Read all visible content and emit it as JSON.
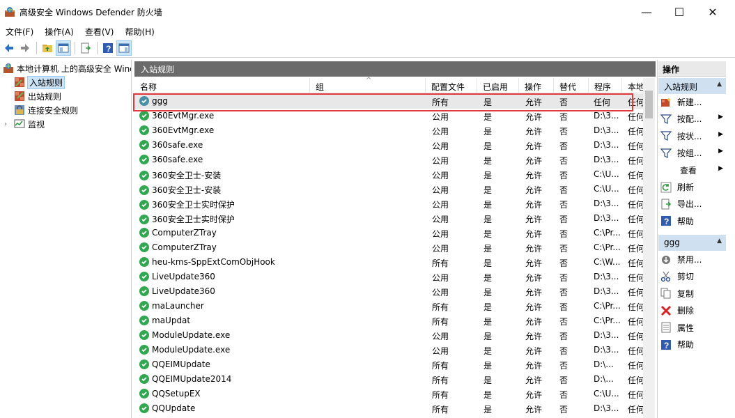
{
  "window": {
    "title": "高级安全 Windows Defender 防火墙",
    "minimize": "—",
    "maximize": "☐",
    "close": "✕"
  },
  "menu": [
    "文件(F)",
    "操作(A)",
    "查看(V)",
    "帮助(H)"
  ],
  "tree": {
    "root": "本地计算机 上的高级安全 Wind",
    "items": [
      "入站规则",
      "出站规则",
      "连接安全规则",
      "监视"
    ],
    "selected": "入站规则"
  },
  "center": {
    "header": "入站规则",
    "columns": [
      "名称",
      "组",
      "配置文件",
      "已启用",
      "操作",
      "替代",
      "程序",
      "本地"
    ],
    "rows": [
      {
        "name": "ggg",
        "group": "",
        "profile": "所有",
        "enabled": "是",
        "action": "允许",
        "override": "否",
        "program": "任何",
        "local": "任何",
        "status": "highlighted"
      },
      {
        "name": "360EvtMgr.exe",
        "group": "",
        "profile": "公用",
        "enabled": "是",
        "action": "允许",
        "override": "否",
        "program": "D:\\3...",
        "local": "任何"
      },
      {
        "name": "360EvtMgr.exe",
        "group": "",
        "profile": "公用",
        "enabled": "是",
        "action": "允许",
        "override": "否",
        "program": "D:\\3...",
        "local": "任何"
      },
      {
        "name": "360safe.exe",
        "group": "",
        "profile": "公用",
        "enabled": "是",
        "action": "允许",
        "override": "否",
        "program": "D:\\3...",
        "local": "任何"
      },
      {
        "name": "360safe.exe",
        "group": "",
        "profile": "公用",
        "enabled": "是",
        "action": "允许",
        "override": "否",
        "program": "D:\\3...",
        "local": "任何"
      },
      {
        "name": "360安全卫士-安装",
        "group": "",
        "profile": "公用",
        "enabled": "是",
        "action": "允许",
        "override": "否",
        "program": "C:\\U...",
        "local": "任何"
      },
      {
        "name": "360安全卫士-安装",
        "group": "",
        "profile": "公用",
        "enabled": "是",
        "action": "允许",
        "override": "否",
        "program": "C:\\U...",
        "local": "任何"
      },
      {
        "name": "360安全卫士实时保护",
        "group": "",
        "profile": "公用",
        "enabled": "是",
        "action": "允许",
        "override": "否",
        "program": "D:\\3...",
        "local": "任何"
      },
      {
        "name": "360安全卫士实时保护",
        "group": "",
        "profile": "公用",
        "enabled": "是",
        "action": "允许",
        "override": "否",
        "program": "D:\\3...",
        "local": "任何"
      },
      {
        "name": "ComputerZTray",
        "group": "",
        "profile": "公用",
        "enabled": "是",
        "action": "允许",
        "override": "否",
        "program": "C:\\Pr...",
        "local": "任何"
      },
      {
        "name": "ComputerZTray",
        "group": "",
        "profile": "公用",
        "enabled": "是",
        "action": "允许",
        "override": "否",
        "program": "C:\\Pr...",
        "local": "任何"
      },
      {
        "name": "heu-kms-SppExtComObjHook",
        "group": "",
        "profile": "所有",
        "enabled": "是",
        "action": "允许",
        "override": "否",
        "program": "C:\\W...",
        "local": "任何"
      },
      {
        "name": "LiveUpdate360",
        "group": "",
        "profile": "公用",
        "enabled": "是",
        "action": "允许",
        "override": "否",
        "program": "D:\\3...",
        "local": "任何"
      },
      {
        "name": "LiveUpdate360",
        "group": "",
        "profile": "公用",
        "enabled": "是",
        "action": "允许",
        "override": "否",
        "program": "D:\\3...",
        "local": "任何"
      },
      {
        "name": "maLauncher",
        "group": "",
        "profile": "所有",
        "enabled": "是",
        "action": "允许",
        "override": "否",
        "program": "C:\\Pr...",
        "local": "任何"
      },
      {
        "name": "maUpdat",
        "group": "",
        "profile": "所有",
        "enabled": "是",
        "action": "允许",
        "override": "否",
        "program": "C:\\Pr...",
        "local": "任何"
      },
      {
        "name": "ModuleUpdate.exe",
        "group": "",
        "profile": "公用",
        "enabled": "是",
        "action": "允许",
        "override": "否",
        "program": "D:\\3...",
        "local": "任何"
      },
      {
        "name": "ModuleUpdate.exe",
        "group": "",
        "profile": "公用",
        "enabled": "是",
        "action": "允许",
        "override": "否",
        "program": "D:\\3...",
        "local": "任何"
      },
      {
        "name": "QQEIMUpdate",
        "group": "",
        "profile": "所有",
        "enabled": "是",
        "action": "允许",
        "override": "否",
        "program": "D:\\...",
        "local": "任何"
      },
      {
        "name": "QQEIMUpdate2014",
        "group": "",
        "profile": "所有",
        "enabled": "是",
        "action": "允许",
        "override": "否",
        "program": "D:\\...",
        "local": "任何"
      },
      {
        "name": "QQSetupEX",
        "group": "",
        "profile": "所有",
        "enabled": "是",
        "action": "允许",
        "override": "否",
        "program": "C:\\U...",
        "local": "任何"
      },
      {
        "name": "QQUpdate",
        "group": "",
        "profile": "所有",
        "enabled": "是",
        "action": "允许",
        "override": "否",
        "program": "D:\\3...",
        "local": "任何"
      }
    ]
  },
  "actions": {
    "header": "操作",
    "section1": "入站规则",
    "section1_items": [
      {
        "label": "新建...",
        "icon": "new-rule-icon"
      },
      {
        "label": "按配...",
        "icon": "filter-icon",
        "submenu": true
      },
      {
        "label": "按状...",
        "icon": "filter-icon",
        "submenu": true
      },
      {
        "label": "按组...",
        "icon": "filter-icon",
        "submenu": true
      },
      {
        "label": "查看",
        "icon": "",
        "submenu": true
      },
      {
        "label": "刷新",
        "icon": "refresh-icon"
      },
      {
        "label": "导出...",
        "icon": "export-icon"
      },
      {
        "label": "帮助",
        "icon": "help-icon"
      }
    ],
    "section2": "ggg",
    "section2_items": [
      {
        "label": "禁用...",
        "icon": "disable-icon"
      },
      {
        "label": "剪切",
        "icon": "cut-icon"
      },
      {
        "label": "复制",
        "icon": "copy-icon"
      },
      {
        "label": "删除",
        "icon": "delete-icon"
      },
      {
        "label": "属性",
        "icon": "properties-icon"
      },
      {
        "label": "帮助",
        "icon": "help-icon"
      }
    ]
  },
  "colors": {
    "accent_highlight": "#e23a3a",
    "enabled_check": "#2fa84f",
    "pane_header": "#6b6b6b",
    "selection": "#cce4f7"
  }
}
